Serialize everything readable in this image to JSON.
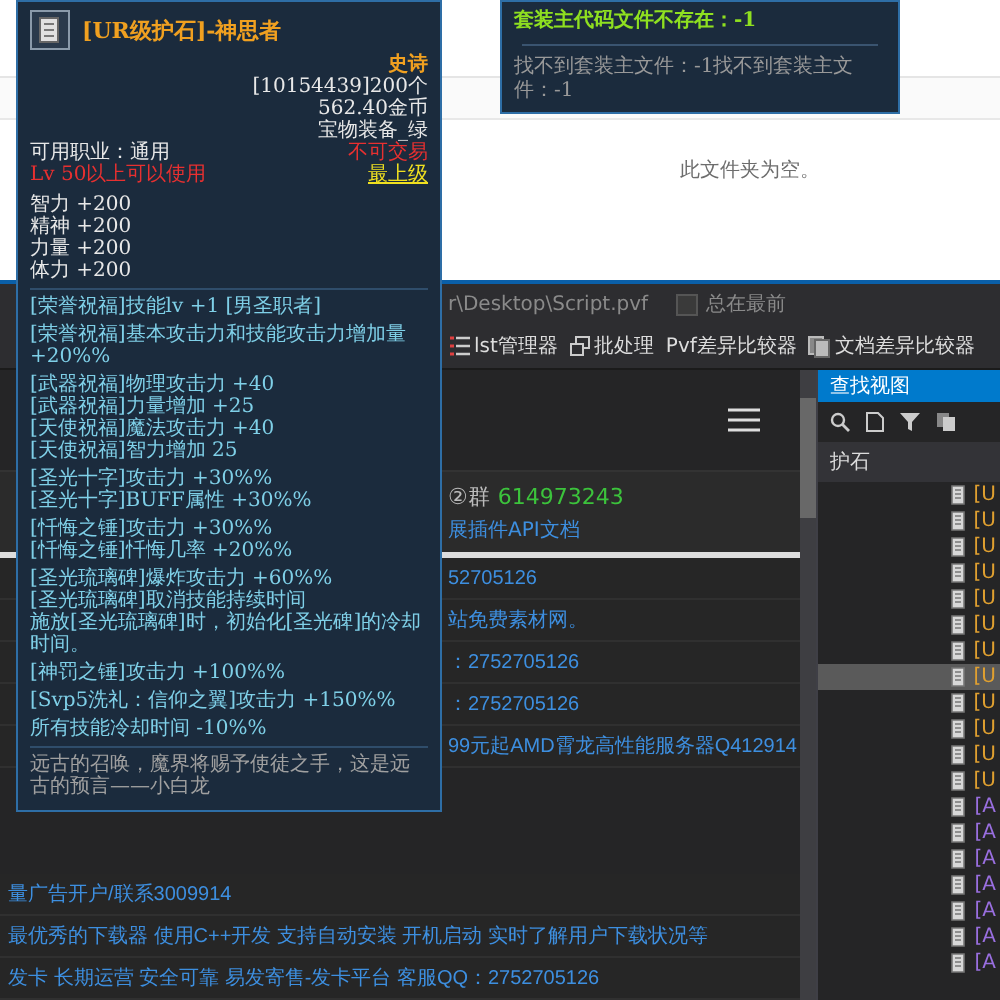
{
  "explorer": {
    "empty_message": "此文件夹为空。"
  },
  "editor": {
    "title_path": "r\\Desktop\\Script.pvf",
    "always_on_top": {
      "label": "总在最前",
      "checked": false
    },
    "toolbar": [
      {
        "label": "lst管理器"
      },
      {
        "label": "批处理"
      },
      {
        "label": "Pvf差异比较器"
      },
      {
        "label": "文档差异比较器"
      }
    ],
    "page": {
      "group_label": "②群",
      "group_number": "614973243",
      "api_link": "展插件API文档",
      "lines": [
        "52705126",
        "站免费素材网。",
        "：2752705126",
        "：2752705126",
        "99元起AMD霄龙高性能服务器Q412914"
      ],
      "lower_lines": [
        "量广告开户/联系3009914",
        "最优秀的下载器 使用C++开发 支持自动安装 开机启动 实时了解用户下载状况等",
        "发卡 长期运营 安全可靠 易发寄售-发卡平台 客服QQ：2752705126"
      ]
    }
  },
  "find_panel": {
    "title": "查找视图",
    "query": "护石",
    "results": [
      {
        "text": "[U",
        "color": "#e0a030",
        "selected": false
      },
      {
        "text": "[U",
        "color": "#e0a030",
        "selected": false
      },
      {
        "text": "[U",
        "color": "#e0a030",
        "selected": false
      },
      {
        "text": "[U",
        "color": "#e0a030",
        "selected": false
      },
      {
        "text": "[U",
        "color": "#e0a030",
        "selected": false
      },
      {
        "text": "[U",
        "color": "#e0a030",
        "selected": false
      },
      {
        "text": "[U",
        "color": "#e0a030",
        "selected": false
      },
      {
        "text": "[U",
        "color": "#e0a030",
        "selected": true
      },
      {
        "text": "[U",
        "color": "#e0a030",
        "selected": false
      },
      {
        "text": "[U",
        "color": "#e0a030",
        "selected": false
      },
      {
        "text": "[U",
        "color": "#e0a030",
        "selected": false
      },
      {
        "text": "[U",
        "color": "#e0a030",
        "selected": false
      },
      {
        "text": "[A",
        "color": "#9a6fe0",
        "selected": false
      },
      {
        "text": "[A",
        "color": "#9a6fe0",
        "selected": false
      },
      {
        "text": "[A",
        "color": "#9a6fe0",
        "selected": false
      },
      {
        "text": "[A",
        "color": "#9a6fe0",
        "selected": false
      },
      {
        "text": "[A",
        "color": "#9a6fe0",
        "selected": false
      },
      {
        "text": "[A",
        "color": "#9a6fe0",
        "selected": false
      },
      {
        "text": "[A",
        "color": "#9a6fe0",
        "selected": false
      }
    ]
  },
  "set_tooltip": {
    "error": "套装主代码文件不存在：-1",
    "detail": "找不到套装主文件：-1找不到套装主文件：-1"
  },
  "item_tooltip": {
    "title": "[UR级护石]-神思者",
    "rarity": "史诗",
    "code": "[10154439]200个",
    "price": "562.40金币",
    "category": "宝物装备_绿",
    "job": "可用职业：通用",
    "level_req": "Lv 50以上可以使用",
    "trade": "不可交易",
    "grade": "最上级",
    "stats": [
      "智力 +200",
      "精神 +200",
      "力量 +200",
      "体力 +200"
    ],
    "effect_groups": [
      [
        "[荣誉祝福]技能lv +1 [男圣职者]"
      ],
      [
        "[荣誉祝福]基本攻击力和技能攻击力增加量 +20%%"
      ],
      [
        "[武器祝福]物理攻击力 +40",
        "[武器祝福]力量增加 +25",
        "[天使祝福]魔法攻击力 +40",
        "[天使祝福]智力增加 25"
      ],
      [
        "[圣光十字]攻击力 +30%%",
        "[圣光十字]BUFF属性 +30%%"
      ],
      [
        "[忏悔之锤]攻击力 +30%%",
        "[忏悔之锤]忏悔几率 +20%%"
      ],
      [
        "[圣光琉璃碑]爆炸攻击力 +60%%",
        "[圣光琉璃碑]取消技能持续时间",
        "施放[圣光琉璃碑]时，初始化[圣光碑]的冷却时间。"
      ],
      [
        "[神罚之锤]攻击力 +100%%"
      ],
      [
        "[Svp5洗礼：信仰之翼]攻击力 +150%%"
      ],
      [
        "所有技能冷却时间 -10%%"
      ]
    ],
    "flavor": "远古的召唤，魔界将赐予使徒之手，这是远古的预言——小白龙"
  }
}
